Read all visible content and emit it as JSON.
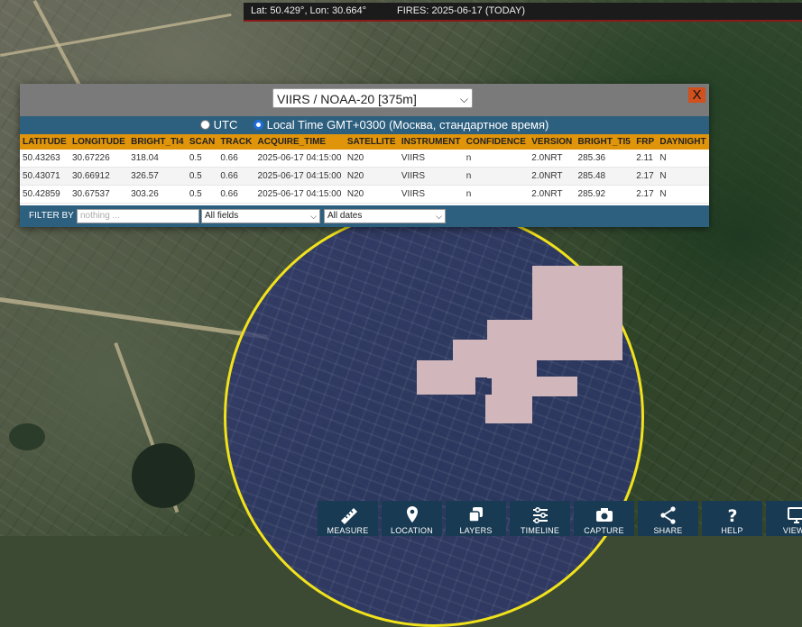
{
  "topbar": {
    "coords": "Lat: 50.429°, Lon: 30.664°",
    "fires": "FIRES: 2025-06-17 (TODAY)"
  },
  "panel": {
    "satellite": "VIIRS / NOAA-20 [375m]",
    "close": "X",
    "tz_utc": "UTC",
    "tz_local": "Local Time GMT+0300 (Москва, стандартное время)",
    "tz_selected": "local",
    "columns": [
      "LATITUDE",
      "LONGITUDE",
      "BRIGHT_TI4",
      "SCAN",
      "TRACK",
      "ACQUIRE_TIME",
      "SATELLITE",
      "INSTRUMENT",
      "CONFIDENCE",
      "VERSION",
      "BRIGHT_TI5",
      "FRP",
      "DAYNIGHT"
    ],
    "rows": [
      [
        "50.43263",
        "30.67226",
        "318.04",
        "0.5",
        "0.66",
        "2025-06-17 04:15:00",
        "N20",
        "VIIRS",
        "n",
        "2.0NRT",
        "285.36",
        "2.11",
        "N"
      ],
      [
        "50.43071",
        "30.66912",
        "326.57",
        "0.5",
        "0.66",
        "2025-06-17 04:15:00",
        "N20",
        "VIIRS",
        "n",
        "2.0NRT",
        "285.48",
        "2.17",
        "N"
      ],
      [
        "50.42859",
        "30.67537",
        "303.26",
        "0.5",
        "0.66",
        "2025-06-17 04:15:00",
        "N20",
        "VIIRS",
        "n",
        "2.0NRT",
        "285.92",
        "2.17",
        "N"
      ]
    ],
    "filter": {
      "label": "FILTER BY",
      "placeholder": "nothing ...",
      "field": "All fields",
      "date": "All dates"
    }
  },
  "toolbar": [
    {
      "label": "MEASURE",
      "icon": "ruler-icon"
    },
    {
      "label": "LOCATION",
      "icon": "map-pin-icon"
    },
    {
      "label": "LAYERS",
      "icon": "layers-icon"
    },
    {
      "label": "TIMELINE",
      "icon": "sliders-icon"
    },
    {
      "label": "CAPTURE",
      "icon": "camera-icon"
    },
    {
      "label": "SHARE",
      "icon": "share-icon"
    },
    {
      "label": "HELP",
      "icon": "question-icon"
    },
    {
      "label": "VIEW I",
      "icon": "monitor-icon"
    }
  ],
  "colors": {
    "fire_pixel": "#d1b6bb",
    "search_ring": "#f1e21b",
    "table_header": "#e0940a",
    "panel_bar": "#2d5f7e",
    "toolbar_bg": "#183a52",
    "close_button": "#d0501e"
  }
}
